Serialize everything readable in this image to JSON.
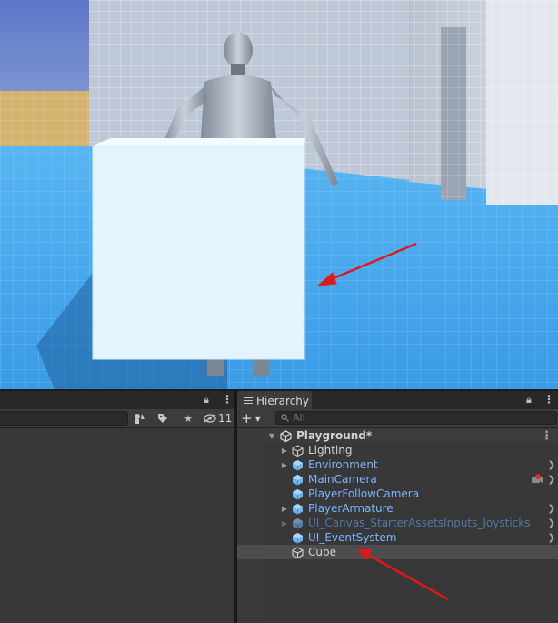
{
  "scene_view": {
    "description_icons": [
      "robot-character",
      "white-cube"
    ],
    "accent": "#e01818"
  },
  "left_panel": {
    "toolbar": {
      "visibility_count": "11",
      "icons": [
        "scene-visibility-icon",
        "tag-icon",
        "star-icon",
        "eye-hidden-icon"
      ]
    }
  },
  "hierarchy": {
    "tab_label": "Hierarchy",
    "add_button": "+",
    "search_placeholder": "All",
    "scene": {
      "name": "Playground*",
      "items": [
        {
          "label": "Lighting",
          "kind": "plain",
          "expandable": true,
          "chevron": false
        },
        {
          "label": "Environment",
          "kind": "prefab",
          "expandable": true,
          "chevron": true
        },
        {
          "label": "MainCamera",
          "kind": "prefab",
          "expandable": false,
          "chevron": true,
          "badge": "camera-gizmo-icon"
        },
        {
          "label": "PlayerFollowCamera",
          "kind": "prefab",
          "expandable": false,
          "chevron": false
        },
        {
          "label": "PlayerArmature",
          "kind": "prefab",
          "expandable": true,
          "chevron": true
        },
        {
          "label": "UI_Canvas_StarterAssetsInputs_Joysticks",
          "kind": "disabled",
          "expandable": true,
          "chevron": true
        },
        {
          "label": "UI_EventSystem",
          "kind": "prefab",
          "expandable": false,
          "chevron": true
        },
        {
          "label": "Cube",
          "kind": "selected",
          "expandable": false,
          "chevron": false
        }
      ]
    }
  },
  "colors": {
    "prefab_blue": "#7cb4ff",
    "panel_bg": "#383838",
    "selection_bg": "#4d4d4d",
    "annotation_red": "#e01818"
  }
}
